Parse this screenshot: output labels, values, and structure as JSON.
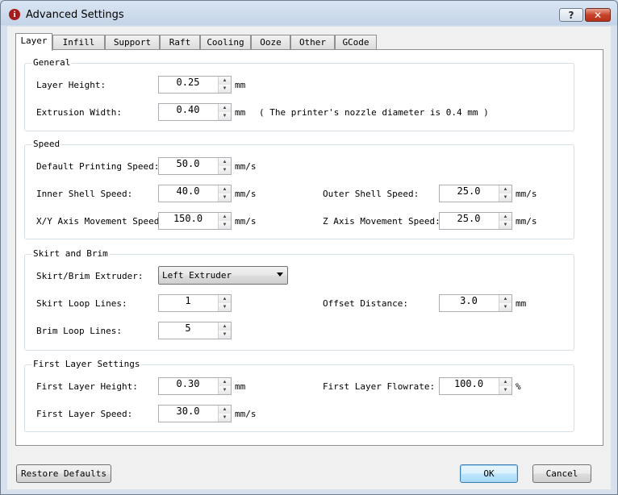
{
  "window": {
    "title": "Advanced Settings",
    "help": "?",
    "close": "✕",
    "app_icon": "i"
  },
  "tabs": [
    "Layer",
    "Infill",
    "Support",
    "Raft",
    "Cooling",
    "Ooze",
    "Other",
    "GCode"
  ],
  "active_tab": "Layer",
  "general": {
    "title": "General",
    "layer_height": {
      "label": "Layer Height:",
      "value": "0.25",
      "unit": "mm"
    },
    "extrusion_width": {
      "label": "Extrusion Width:",
      "value": "0.40",
      "unit": "mm",
      "note": "( The printer's nozzle diameter is 0.4 mm )"
    }
  },
  "speed": {
    "title": "Speed",
    "default_print": {
      "label": "Default Printing Speed:",
      "value": "50.0",
      "unit": "mm/s"
    },
    "inner_shell": {
      "label": "Inner Shell Speed:",
      "value": "40.0",
      "unit": "mm/s"
    },
    "outer_shell": {
      "label": "Outer Shell Speed:",
      "value": "25.0",
      "unit": "mm/s"
    },
    "xy_move": {
      "label": "X/Y Axis Movement Speed:",
      "value": "150.0",
      "unit": "mm/s"
    },
    "z_move": {
      "label": "Z Axis Movement Speed:",
      "value": "25.0",
      "unit": "mm/s"
    }
  },
  "skirt": {
    "title": "Skirt and Brim",
    "extruder": {
      "label": "Skirt/Brim Extruder:",
      "value": "Left Extruder"
    },
    "loop_lines": {
      "label": "Skirt Loop Lines:",
      "value": "1"
    },
    "offset": {
      "label": "Offset Distance:",
      "value": "3.0",
      "unit": "mm"
    },
    "brim_lines": {
      "label": "Brim Loop Lines:",
      "value": "5"
    }
  },
  "first_layer": {
    "title": "First Layer Settings",
    "height": {
      "label": "First Layer Height:",
      "value": "0.30",
      "unit": "mm"
    },
    "flowrate": {
      "label": "First Layer Flowrate:",
      "value": "100.0",
      "unit": "%"
    },
    "speed": {
      "label": "First Layer Speed:",
      "value": "30.0",
      "unit": "mm/s"
    }
  },
  "buttons": {
    "restore": "Restore Defaults",
    "ok": "OK",
    "cancel": "Cancel"
  },
  "spin_up_glyph": "▲",
  "spin_down_glyph": "▼"
}
